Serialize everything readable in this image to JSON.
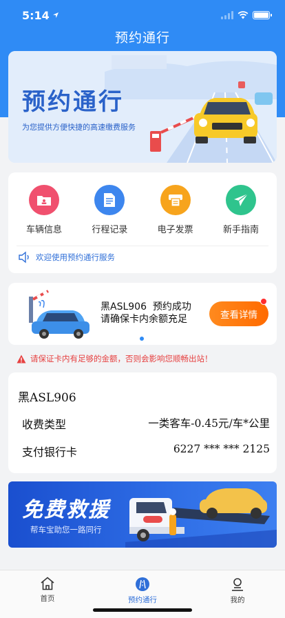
{
  "status_bar": {
    "time": "5:14"
  },
  "nav": {
    "title": "预约通行"
  },
  "hero": {
    "title": "预约通行",
    "subtitle": "为您提供方便快捷的高速缴费服务"
  },
  "menu": {
    "items": [
      {
        "label": "车辆信息",
        "icon": "vehicle-card-icon",
        "color": "#f0506e"
      },
      {
        "label": "行程记录",
        "icon": "document-icon",
        "color": "#3d86ee"
      },
      {
        "label": "电子发票",
        "icon": "invoice-printer-icon",
        "color": "#f7a41d"
      },
      {
        "label": "新手指南",
        "icon": "paper-plane-icon",
        "color": "#2fc48d"
      }
    ],
    "notice": "欢迎使用预约通行服务"
  },
  "reservation": {
    "line1": "黑ASL906  预约成功",
    "line2": "请确保卡内余额充足",
    "button": "查看详情"
  },
  "warning": "请保证卡内有足够的金额，否则会影响您顺畅出站！",
  "info": {
    "plate": "黑ASL906",
    "fee_type_label": "收费类型",
    "fee_type_value": "一类客车-0.45元/车*公里",
    "bank_label": "支付银行卡",
    "bank_value": "6227 *** *** 2125"
  },
  "rescue": {
    "title": "免费救援",
    "subtitle": "帮车宝助您一路同行"
  },
  "tabbar": {
    "tabs": [
      {
        "label": "首页",
        "icon": "home-icon"
      },
      {
        "label": "预约通行",
        "icon": "road-icon",
        "active": true
      },
      {
        "label": "我的",
        "icon": "user-icon"
      }
    ]
  },
  "colors": {
    "brand_blue": "#2f8bf5",
    "accent_orange": "#ff7a0e",
    "warning_red": "#e64141"
  }
}
